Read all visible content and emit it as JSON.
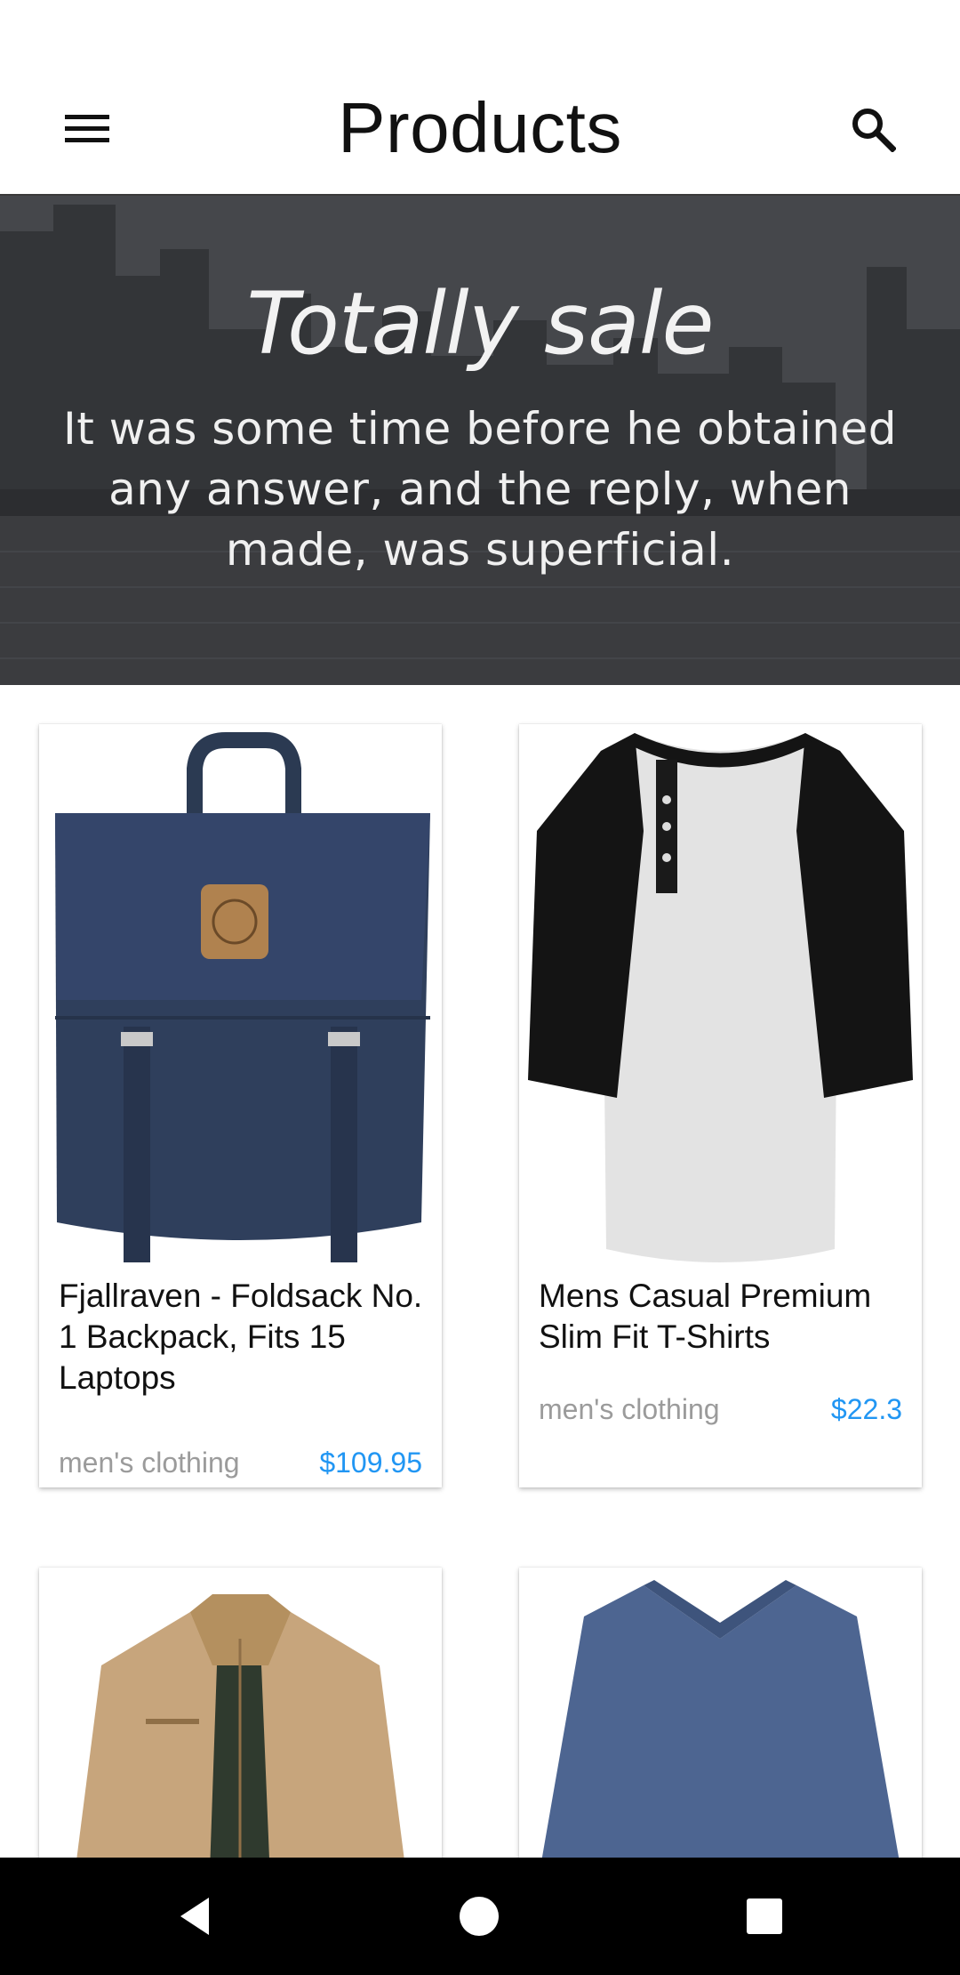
{
  "app_bar": {
    "title": "Products",
    "menu_icon": "hamburger-menu-icon",
    "search_icon": "search-icon"
  },
  "banner": {
    "title": "Totally sale",
    "text": "It was some time before he obtained any answer, and the reply, when made, was superficial."
  },
  "products": [
    {
      "name": "Fjallraven - Foldsack No. 1 Backpack, Fits 15 Laptops",
      "category": "men's clothing",
      "price": "$109.95",
      "image": "navy-backpack"
    },
    {
      "name": "Mens Casual Premium Slim Fit T-Shirts",
      "category": "men's clothing",
      "price": "$22.3",
      "image": "raglan-henley-tshirt"
    },
    {
      "name": "",
      "category": "",
      "price": "",
      "image": "khaki-jacket"
    },
    {
      "name": "",
      "category": "",
      "price": "",
      "image": "blue-vneck-longsleeve"
    }
  ],
  "nav_bar": {
    "back_icon": "back-triangle-icon",
    "home_icon": "home-circle-icon",
    "recents_icon": "recents-square-icon"
  },
  "colors": {
    "price": "#2196f3",
    "category": "#9b9b9b",
    "banner_overlay": "#3b3c3f",
    "nav_bar": "#000000"
  }
}
